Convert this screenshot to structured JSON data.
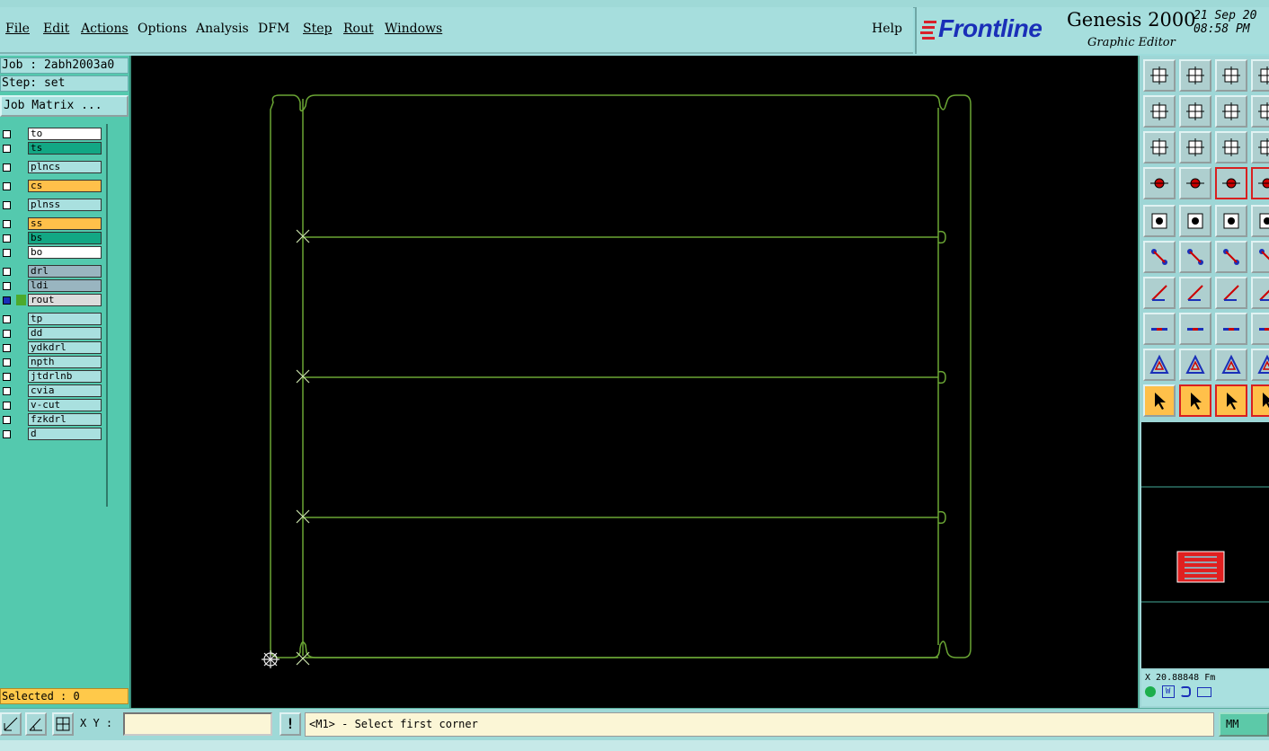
{
  "menu": {
    "items": [
      "File",
      "Edit",
      "Actions",
      "Options",
      "Analysis",
      "DFM",
      "Step",
      "Rout",
      "Windows"
    ],
    "help": "Help"
  },
  "brand": {
    "logo": "Frontline",
    "title": "Genesis 2000",
    "subtitle": "Graphic Editor",
    "date_line1": "21 Sep 20",
    "date_line2": "08:58 PM"
  },
  "left": {
    "job": "Job : 2abh2003a0",
    "step": "Step: set",
    "job_matrix": "Job Matrix ...",
    "selected": "Selected : 0"
  },
  "layers": [
    {
      "name": "to",
      "color": "#ffffff"
    },
    {
      "name": "ts",
      "color": "#12a784"
    },
    {
      "name": "plncs",
      "color": "#a9e0df"
    },
    {
      "name": "cs",
      "color": "#ffc04a"
    },
    {
      "name": "plnss",
      "color": "#a9e0df"
    },
    {
      "name": "ss",
      "color": "#ffc04a"
    },
    {
      "name": "bs",
      "color": "#12a784"
    },
    {
      "name": "bo",
      "color": "#ffffff"
    },
    {
      "name": "drl",
      "color": "#99b5c0"
    },
    {
      "name": "ldi",
      "color": "#99b5c0"
    },
    {
      "name": "rout",
      "color": "#dcdcdc"
    },
    {
      "name": "tp",
      "color": "#a9e0df"
    },
    {
      "name": "dd",
      "color": "#a9e0df"
    },
    {
      "name": "ydkdrl",
      "color": "#a9e0df"
    },
    {
      "name": "npth",
      "color": "#a9e0df"
    },
    {
      "name": "jtdrlnb",
      "color": "#a9e0df"
    },
    {
      "name": "cvia",
      "color": "#a9e0df"
    },
    {
      "name": "v-cut",
      "color": "#a9e0df"
    },
    {
      "name": "fzkdrl",
      "color": "#a9e0df"
    },
    {
      "name": "d",
      "color": "#a9e0df"
    }
  ],
  "bottom": {
    "xy_label": "X Y :",
    "xy_value": "",
    "prompt": "<M1> - Select first corner",
    "units": "MM"
  },
  "coord_readout": "X 20.88848 Fm",
  "colors": {
    "outline": "#6aa534",
    "accent": "#1a2fb8"
  }
}
